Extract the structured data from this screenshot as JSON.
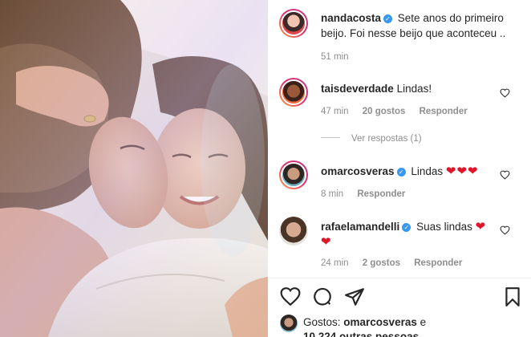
{
  "post": {
    "author": "nandacosta",
    "caption": "Sete anos do primeiro beijo. Foi nesse beijo que aconteceu ..",
    "time": "51 min"
  },
  "comments": [
    {
      "user": "taisdeverdade",
      "verified": false,
      "text": "Lindas!",
      "time": "47 min",
      "likes": "20 gostos",
      "reply": "Responder"
    },
    {
      "user": "omarcosveras",
      "verified": true,
      "text": "Lindas",
      "emoji": "❤❤❤",
      "time": "8 min",
      "reply": "Responder"
    },
    {
      "user": "rafaelamandelli",
      "verified": true,
      "text": "Suas lindas",
      "emoji": "❤",
      "emoji2": "❤",
      "time": "24 min",
      "likes": "2 gostos",
      "reply": "Responder"
    }
  ],
  "view_replies": "Ver respostas (1)",
  "likes": {
    "prefix": "Gostos: ",
    "user": "omarcosveras",
    "mid": " e",
    "others": "10.224 outras pessoas"
  },
  "icons": {
    "like": "heart-outline-icon",
    "comment": "comment-bubble-icon",
    "share": "paper-plane-icon",
    "save": "bookmark-icon",
    "verified": "verified-badge-icon"
  },
  "colors": {
    "verified": "#3897f0",
    "heart_red": "#e0152a",
    "muted": "#8e8e8e"
  }
}
